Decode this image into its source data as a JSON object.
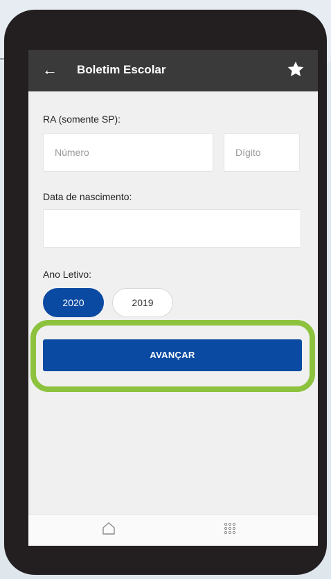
{
  "header": {
    "title": "Boletim Escolar",
    "back_icon": "arrow-left-icon",
    "favorite_icon": "star-icon"
  },
  "ra": {
    "label": "RA (somente SP):",
    "numero_placeholder": "Número",
    "digito_placeholder": "Dígito",
    "numero_value": "",
    "digito_value": ""
  },
  "birth": {
    "label": "Data de nascimento:",
    "value": ""
  },
  "year": {
    "label": "Ano Letivo:",
    "options": [
      "2020",
      "2019"
    ],
    "selected": "2020"
  },
  "actions": {
    "next_label": "AVANÇAR"
  },
  "bottom_nav": {
    "items": [
      {
        "icon": "home-icon"
      },
      {
        "icon": "grid-icon"
      }
    ]
  },
  "colors": {
    "primary": "#0b4aa2",
    "appbar": "#3a3a3a",
    "highlight": "#8dc23f",
    "device": "#231f20"
  }
}
